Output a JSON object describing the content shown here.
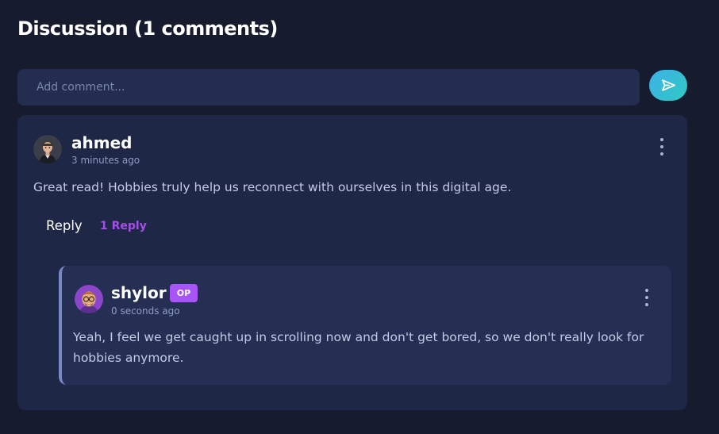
{
  "discussion": {
    "title": "Discussion (1 comments)",
    "input_placeholder": "Add comment...",
    "send_icon": "send-icon"
  },
  "comment": {
    "author": "ahmed",
    "time": "3 minutes ago",
    "text": "Great read! Hobbies truly help us reconnect with ourselves in this digital age.",
    "reply_label": "Reply",
    "replies_label": "1 Reply",
    "more_icon": "more-vertical-icon",
    "reply": {
      "author": "shylor",
      "badge": "OP",
      "time": "0 seconds ago",
      "text": "Yeah, I feel we get caught up in scrolling now and don't get bored, so we don't really look for hobbies anymore.",
      "more_icon": "more-vertical-icon"
    }
  },
  "colors": {
    "background": "#161b2e",
    "card": "#1f2746",
    "reply_card": "#252f54",
    "accent_purple": "#a855f7",
    "send_gradient_start": "#3fb0e8",
    "send_gradient_end": "#2fc9c4"
  }
}
